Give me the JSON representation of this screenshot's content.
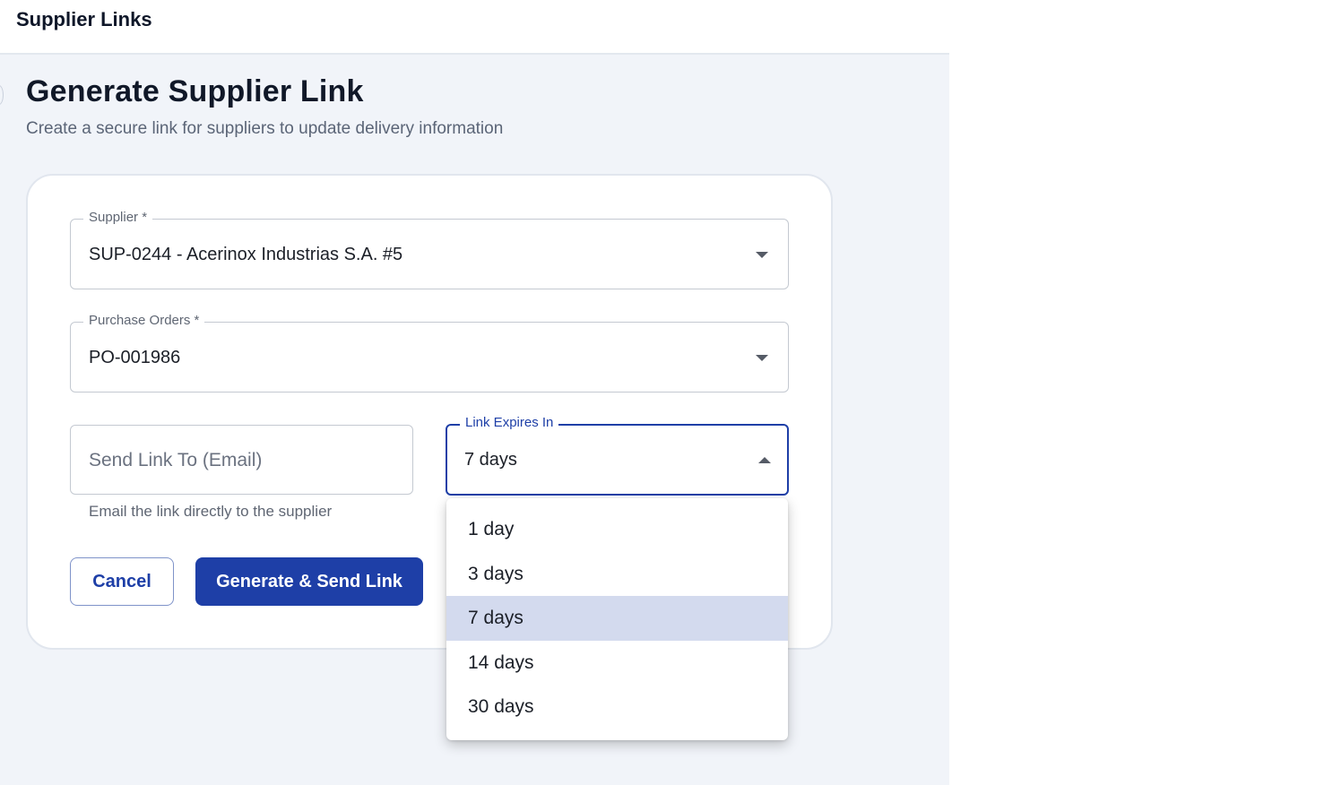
{
  "app": {
    "title": "Supplier Links"
  },
  "page": {
    "title": "Generate Supplier Link",
    "subtitle": "Create a secure link for suppliers to update delivery information"
  },
  "form": {
    "supplier": {
      "label": "Supplier *",
      "value": "SUP-0244 - Acerinox Industrias S.A. #5"
    },
    "purchase_orders": {
      "label": "Purchase Orders *",
      "value": "PO-001986"
    },
    "email": {
      "placeholder": "Send Link To (Email)",
      "helper": "Email the link directly to the supplier"
    },
    "expires": {
      "label": "Link Expires In",
      "value": "7 days",
      "options": [
        "1 day",
        "3 days",
        "7 days",
        "14 days",
        "30 days"
      ],
      "selected_index": 2
    },
    "actions": {
      "cancel": "Cancel",
      "submit": "Generate & Send Link"
    }
  },
  "colors": {
    "accent": "#1e3fa7",
    "page_background": "#f1f4f9",
    "selected_option": "#d3daee"
  },
  "icons": {
    "supplier_dropdown": "chevron-down-icon",
    "po_dropdown": "chevron-down-icon",
    "expires_dropdown": "chevron-up-icon"
  }
}
